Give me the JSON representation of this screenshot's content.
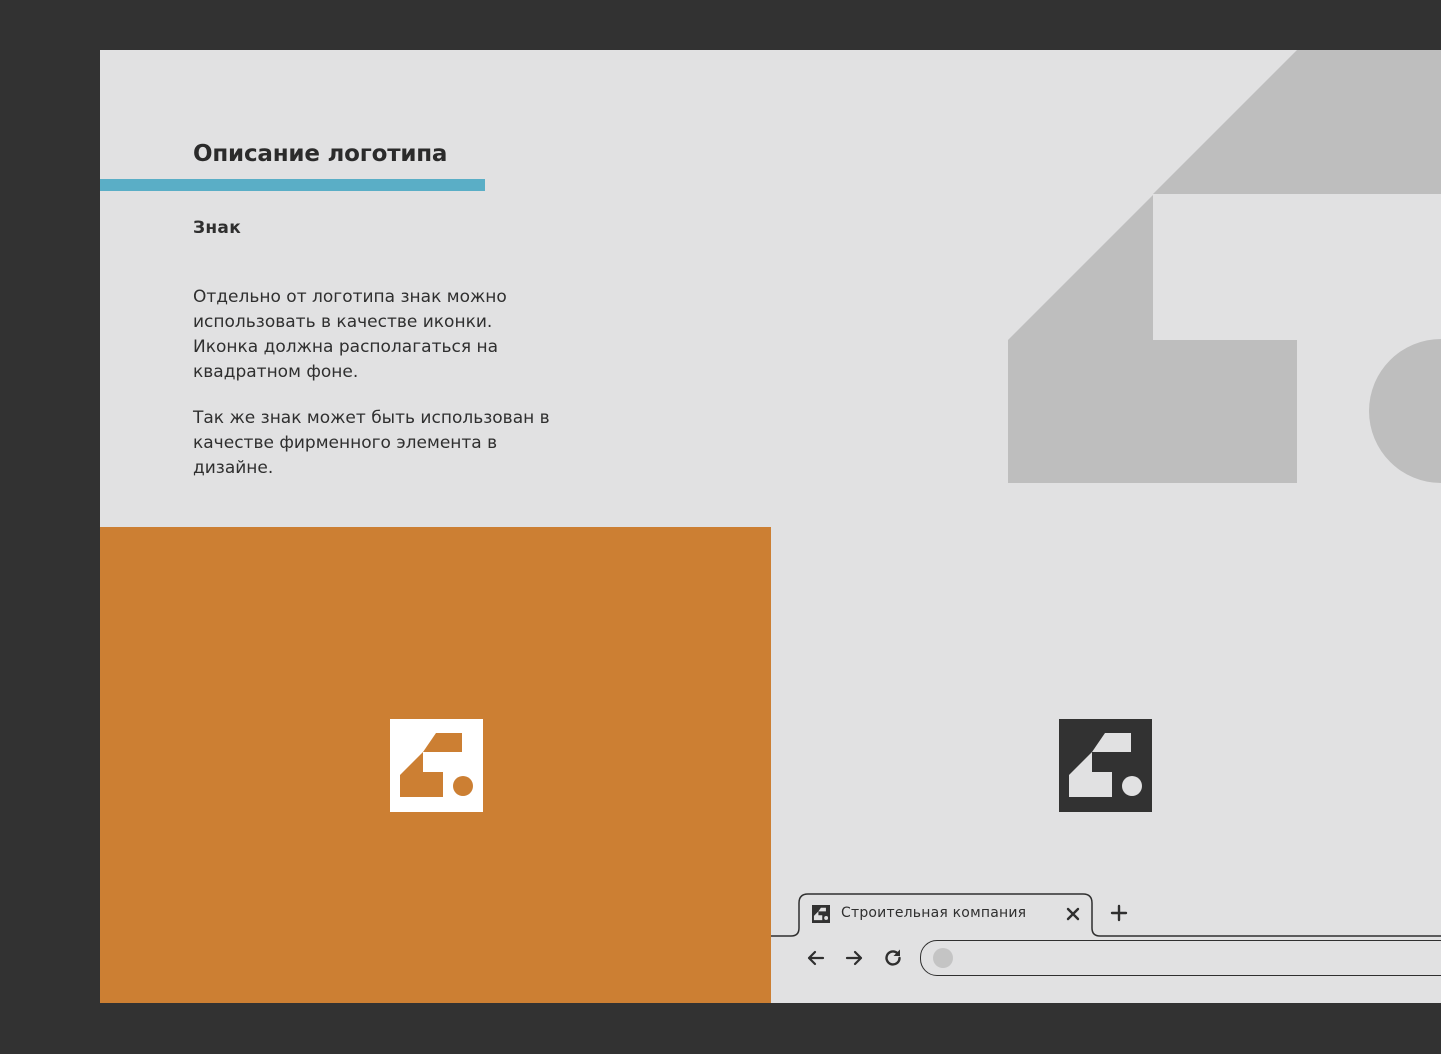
{
  "slide": {
    "title": "Описание логотипа",
    "subtitle": "Знак",
    "paragraph_1": "Отдельно от логотипа знак можно\nиспользовать в качестве иконки.\nИконка должна располагаться на\nквадратном фоне.",
    "paragraph_2": "Так же знак может быть использован в\nкачестве фирменного элемента в\nдизайне."
  },
  "colors": {
    "page_background": "#323232",
    "slide_background": "#e1e1e2",
    "accent_blue": "#5aaec6",
    "brand_orange": "#cc7f33",
    "mark_grey": "#bebebe",
    "dark": "#323232",
    "text": "#2f2f2f"
  },
  "browser": {
    "tab_label": "Строительная компания",
    "tab_favicon": "logo-mark-icon",
    "close_icon": "close-icon",
    "new_tab_icon": "plus-icon",
    "nav_icons": [
      "arrow-left-icon",
      "arrow-right-icon",
      "reload-icon"
    ]
  }
}
